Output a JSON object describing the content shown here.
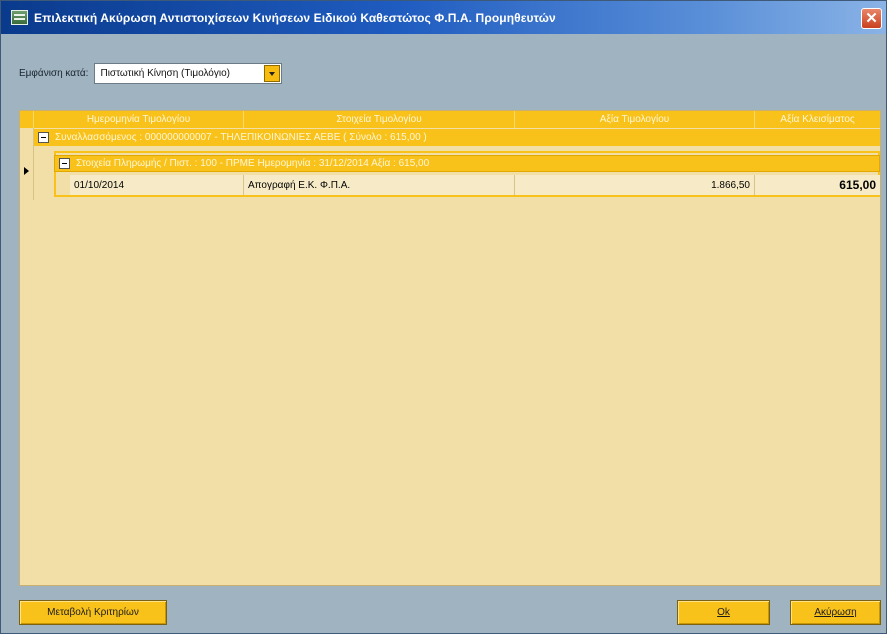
{
  "window": {
    "title": "Επιλεκτική Ακύρωση Αντιστοιχίσεων Κινήσεων Ειδικού Καθεστώτος Φ.Π.Α. Προμηθευτών",
    "close_glyph": "✕"
  },
  "filter": {
    "label": "Εμφάνιση κατά:",
    "value": "Πιστωτική Κίνηση (Τιμολόγιο)"
  },
  "grid": {
    "columns": [
      "Ημερομηνία Τιμολογίου",
      "Στοιχεία Τιμολογίου",
      "Αξία Τιμολογίου",
      "Αξία Κλεισίματος"
    ],
    "group1": "Συναλλασσόμενος : 000000000007 - ΤΗΛΕΠΙΚΟΙΝΩΝΙΕΣ ΑΕΒΕ ( Σύνολο : 615,00 )",
    "group2": "Στοιχεία Πληρωμής / Πιστ. : 100 - ΠΡΜΕ Ημερομηνία : 31/12/2014 Αξία : 615,00",
    "rows": [
      {
        "date": "01/10/2014",
        "description": "Απογραφή Ε.Κ. Φ.Π.Α.",
        "invoice_value": "1.866,50",
        "closing_value": "615,00"
      }
    ]
  },
  "buttons": {
    "criteria": "Μεταβολή Κριτηρίων",
    "ok": "Ok",
    "cancel": "Ακύρωση"
  }
}
